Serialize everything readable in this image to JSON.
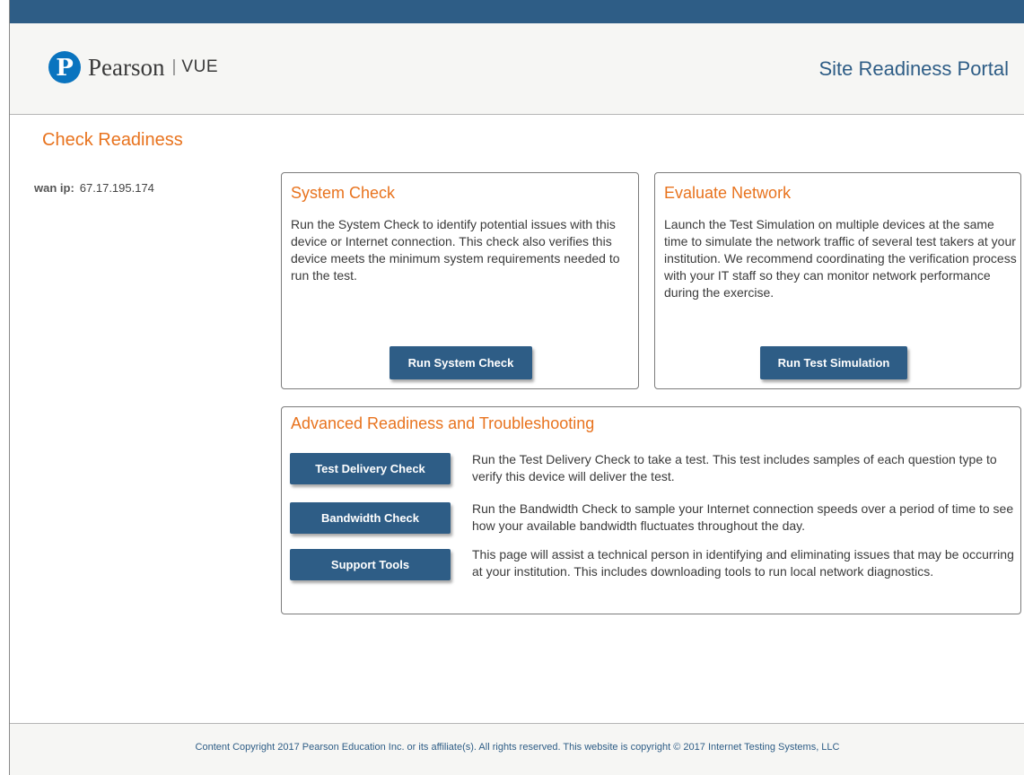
{
  "header": {
    "logo_mark": "P",
    "logo_word": "Pearson",
    "logo_sep": "|",
    "logo_vue": "VUE",
    "portal_title": "Site Readiness Portal"
  },
  "page_title": "Check Readiness",
  "wan": {
    "label": "wan ip:",
    "value": "67.17.195.174"
  },
  "system_check": {
    "title": "System Check",
    "text": "Run the System Check to identify potential issues with this device or Internet connection. This check also verifies this device meets the minimum system requirements needed to run the test.",
    "button": "Run System Check"
  },
  "evaluate_network": {
    "title": "Evaluate Network",
    "text": "Launch the Test Simulation on multiple devices at the same time to simulate the network traffic of several test takers at your institution. We recommend coordinating the verification process with your IT staff so they can monitor network performance during the exercise.",
    "button": "Run Test Simulation"
  },
  "advanced": {
    "title": "Advanced Readiness and Troubleshooting",
    "items": [
      {
        "button": "Test Delivery Check",
        "text": "Run the Test Delivery Check to take a test. This test includes samples of each question type to verify this device will deliver the test."
      },
      {
        "button": "Bandwidth Check",
        "text": "Run the Bandwidth Check to sample your Internet connection speeds over a period of time to see how your available bandwidth fluctuates throughout the day."
      },
      {
        "button": "Support Tools",
        "text": "This page will assist a technical person in identifying and eliminating issues that may be occurring at your institution. This includes downloading tools to run local network diagnostics."
      }
    ]
  },
  "footer": {
    "text": "Content Copyright 2017 Pearson Education Inc. or its affiliate(s). All rights reserved. This website is copyright © 2017 Internet Testing Systems, LLC"
  },
  "colors": {
    "brand_blue": "#2e5d86",
    "accent_orange": "#e8731e",
    "logo_blue": "#0a74bf"
  }
}
